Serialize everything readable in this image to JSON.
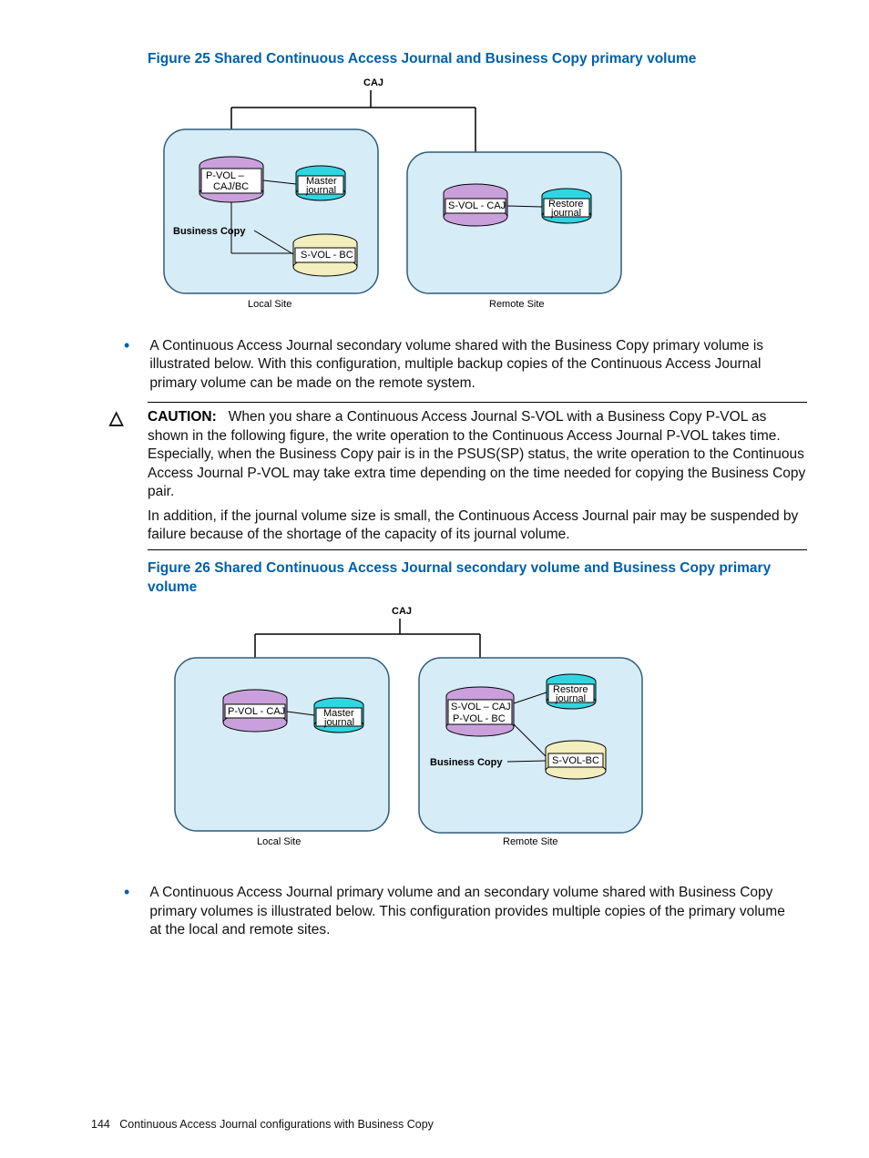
{
  "fig25": {
    "caption": "Figure 25 Shared Continuous Access Journal and Business Copy primary volume",
    "top_label": "CAJ",
    "local": {
      "site_label": "Local Site",
      "pvol_line1": "P-VOL –",
      "pvol_line2": "CAJ/BC",
      "journal_line1": "Master",
      "journal_line2": "journal",
      "bc_label": "Business Copy",
      "svol": "S-VOL - BC"
    },
    "remote": {
      "site_label": "Remote Site",
      "svol": "S-VOL - CAJ",
      "journal_line1": "Restore",
      "journal_line2": "journal"
    }
  },
  "bullet1": "A Continuous Access Journal secondary volume shared with the Business Copy primary volume is illustrated below. With this configuration, multiple backup copies of the Continuous Access Journal primary volume can be made on the remote system.",
  "caution": {
    "label": "CAUTION:",
    "p1": "When you share a Continuous Access Journal S-VOL with a Business Copy P-VOL as shown in the following figure, the write operation to the Continuous Access Journal P-VOL takes time. Especially, when the Business Copy pair is in the PSUS(SP) status, the write operation to the Continuous Access Journal P-VOL may take extra time depending on the time needed for copying the Business Copy pair.",
    "p2": "In addition, if the journal volume size is small, the Continuous Access Journal pair may be suspended by failure because of the shortage of the capacity of its journal volume."
  },
  "fig26": {
    "caption": "Figure 26 Shared Continuous Access Journal secondary volume and Business Copy primary volume",
    "top_label": "CAJ",
    "local": {
      "site_label": "Local Site",
      "pvol": "P-VOL - CAJ",
      "journal_line1": "Master",
      "journal_line2": "journal"
    },
    "remote": {
      "site_label": "Remote Site",
      "svol_line1": "S-VOL – CAJ",
      "svol_line2": "P-VOL - BC",
      "journal_line1": "Restore",
      "journal_line2": "journal",
      "bc_label": "Business Copy",
      "svol_bc": "S-VOL-BC"
    }
  },
  "bullet2": "A Continuous Access Journal primary volume and an secondary volume shared with Business Copy primary volumes is illustrated below. This configuration provides multiple copies of the primary volume at the local and remote sites.",
  "footer": {
    "page": "144",
    "section": "Continuous Access Journal configurations with Business Copy"
  }
}
